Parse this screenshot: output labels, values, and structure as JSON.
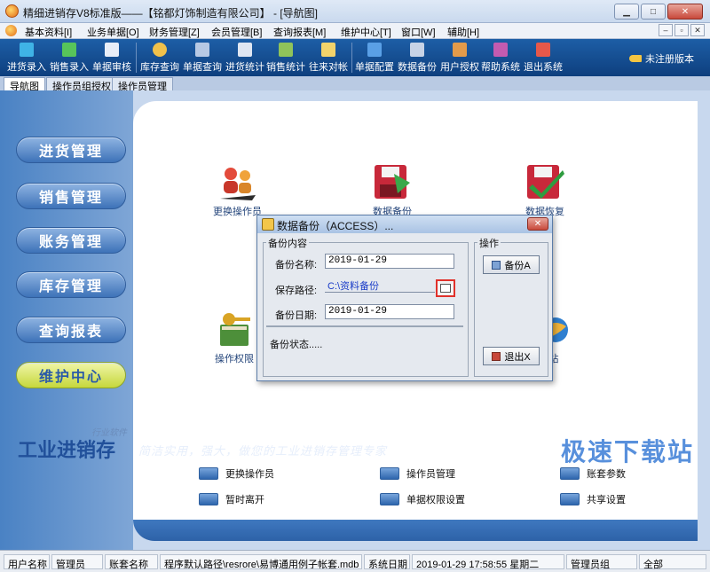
{
  "window": {
    "title": "精细进销存V8标准版——【铭都灯饰制造有限公司】 - [导航图]",
    "buttons": [
      "minimize",
      "maximize",
      "close"
    ]
  },
  "menubar": {
    "items": [
      "基本资料[I]",
      "业务单据[O]",
      "财务管理[Z]",
      "会员管理[B]",
      "查询报表[M]",
      "维护中心[T]",
      "窗口[W]",
      "辅助[H]"
    ]
  },
  "toolbar": {
    "buttons": [
      "进货录入",
      "销售录入",
      "单据审核",
      "库存查询",
      "单据查询",
      "进货统计",
      "销售统计",
      "往来对帐",
      "单据配置",
      "数据备份",
      "用户授权",
      "帮助系统",
      "退出系统"
    ],
    "register_label": "未注册版本"
  },
  "tabs": [
    "导航图",
    "操作员组授权",
    "操作员管理"
  ],
  "sidebar": {
    "items": [
      "进货管理",
      "销售管理",
      "账务管理",
      "库存管理",
      "查询报表",
      "维护中心"
    ],
    "active": "维护中心"
  },
  "nav_icons": {
    "change_operator": "更换操作员",
    "data_backup": "数据备份",
    "data_restore": "数据恢复",
    "operator_rights": "操作权限",
    "station_partial": "站"
  },
  "quick_links": [
    "更换操作员",
    "操作员管理",
    "账套参数",
    "暂时离开",
    "单据权限设置",
    "共享设置"
  ],
  "branding": {
    "product": "工业进销存",
    "small": "行业软件",
    "slogan": "简洁实用，强大，做您的工业进销存管理专家",
    "watermark": "极速下载站"
  },
  "statusbar": {
    "user_label": "用户名称",
    "user_value": "管理员",
    "account_label": "账套名称",
    "account_value": "程序默认路径\\resrore\\易博通用例子帐套.mdb",
    "date_label": "系统日期",
    "date_value": "2019-01-29  17:58:55  星期二",
    "role_value": "管理员组",
    "scope_value": "全部"
  },
  "dialog": {
    "title": "数据备份（ACCESS）...",
    "group_content": "备份内容",
    "group_ops": "操作",
    "name_label": "备份名称:",
    "name_value": "2019-01-29",
    "path_label": "保存路径:",
    "path_value": "C:\\资料备份",
    "date_label": "备份日期:",
    "date_value": "2019-01-29",
    "status_label": "备份状态.....",
    "backup_button": "备份A",
    "exit_button": "退出X"
  },
  "colors": {
    "toolbar_bg": "#1d5ea6",
    "sidebar_active": "#c6d73c",
    "highlight_box": "#e0312b"
  }
}
